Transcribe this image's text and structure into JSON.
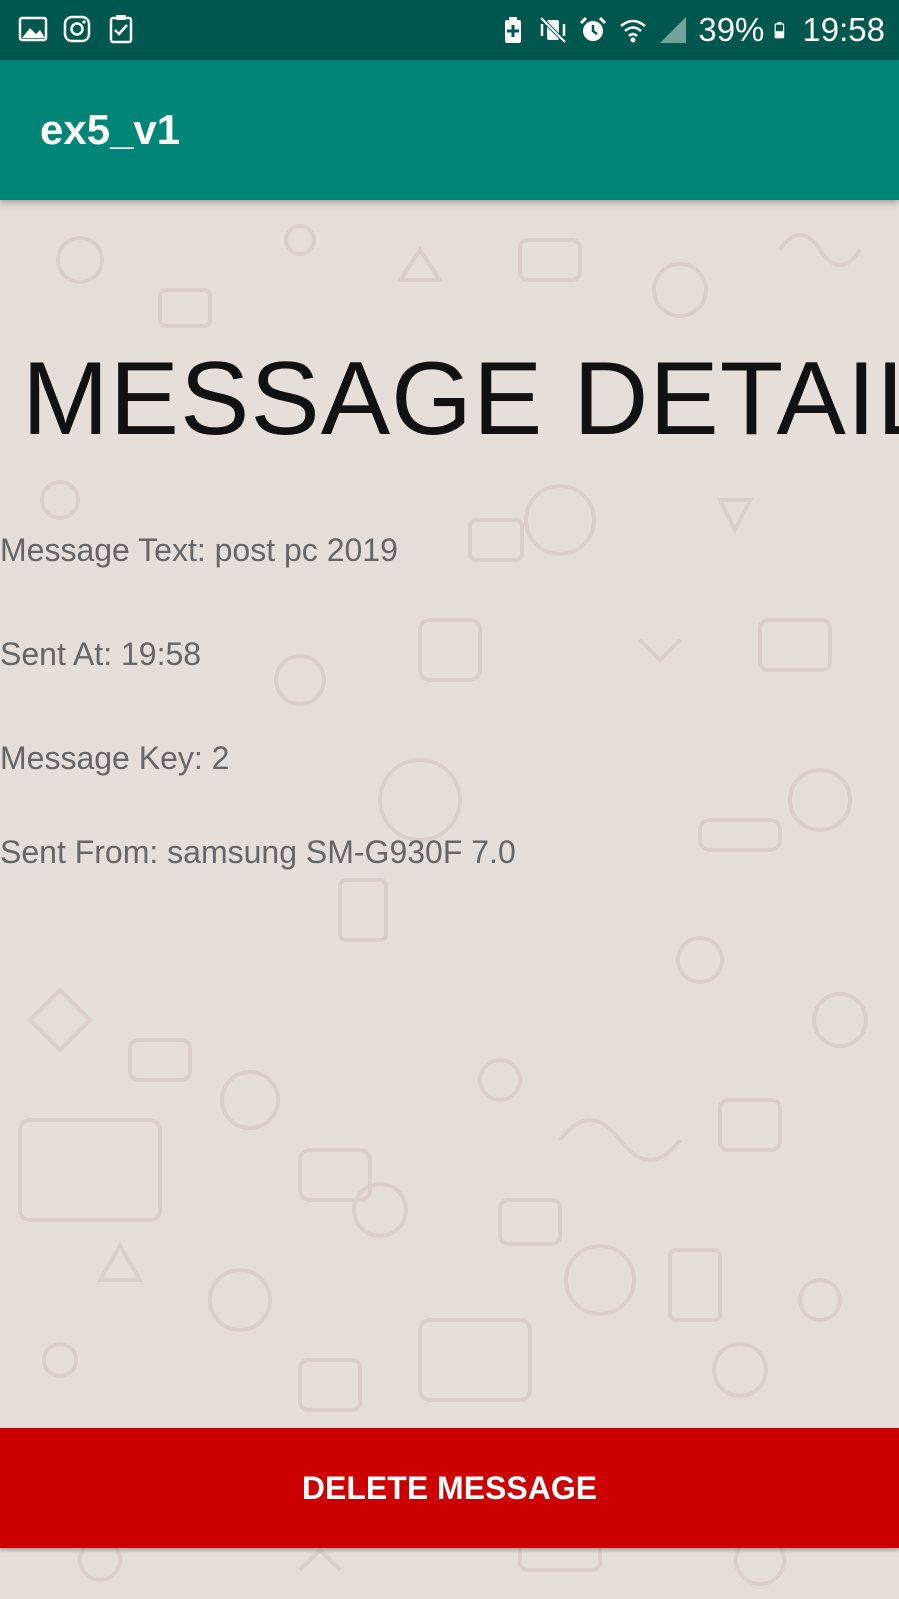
{
  "status_bar": {
    "left_icons": [
      "gallery-icon",
      "instagram-icon",
      "task-check-icon"
    ],
    "right_icons": [
      "battery-saver-icon",
      "vibrate-mute-icon",
      "alarm-icon",
      "wifi-icon",
      "signal-icon",
      "battery-icon"
    ],
    "battery": "39%",
    "time": "19:58"
  },
  "app_bar": {
    "title": "ex5_v1",
    "color": "#008577"
  },
  "main": {
    "heading": "MESSAGE DETAIL",
    "message_text": "Message Text: post pc 2019",
    "sent_at": "Sent At: 19:58",
    "message_key": "Message Key: 2",
    "sent_from": "Sent From: samsung SM-G930F 7.0"
  },
  "actions": {
    "delete_label": "DELETE MESSAGE",
    "delete_color": "#cc0000"
  }
}
